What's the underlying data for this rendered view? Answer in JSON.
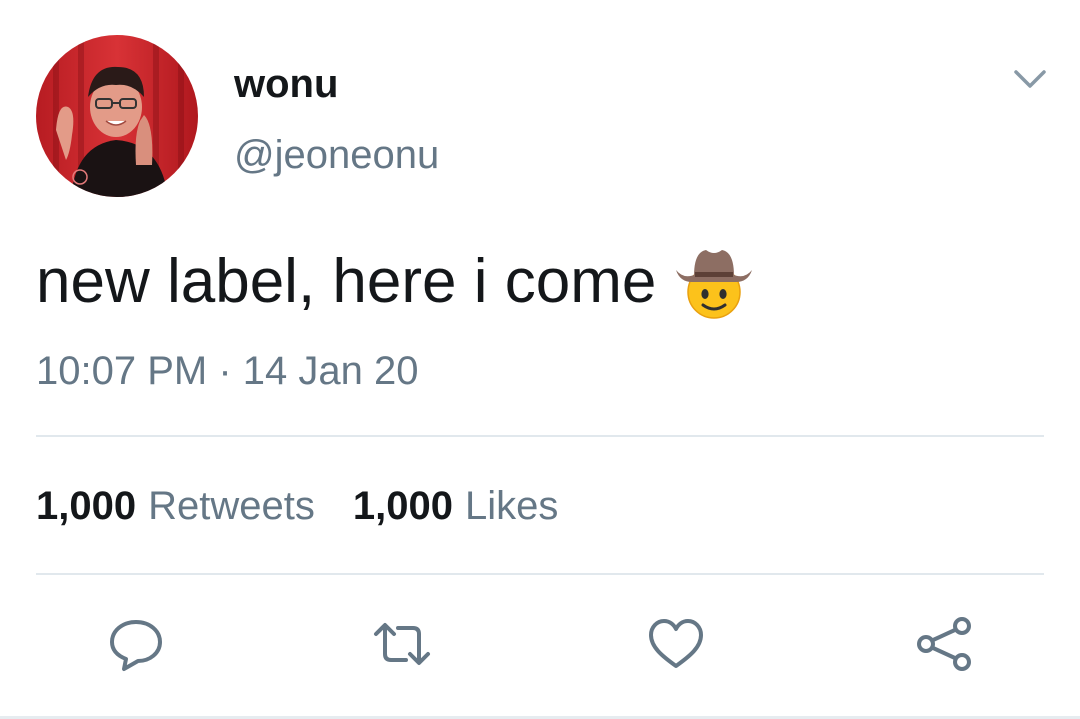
{
  "user": {
    "display_name": "wonu",
    "handle": "@jeoneonu"
  },
  "tweet": {
    "text": "new label, here i come",
    "emoji": "cowboy-hat-face-emoji",
    "timestamp": "10:07 PM · 14 Jan 20"
  },
  "stats": {
    "retweets_count": "1,000",
    "retweets_label": "Retweets",
    "likes_count": "1,000",
    "likes_label": "Likes"
  },
  "icons": {
    "menu": "chevron-down-icon",
    "reply": "reply-icon",
    "retweet": "retweet-icon",
    "like": "heart-icon",
    "share": "share-icon"
  },
  "colors": {
    "primary_text": "#14171a",
    "secondary_text": "#657786",
    "divider": "#e1e8ed",
    "icon": "#657786"
  }
}
